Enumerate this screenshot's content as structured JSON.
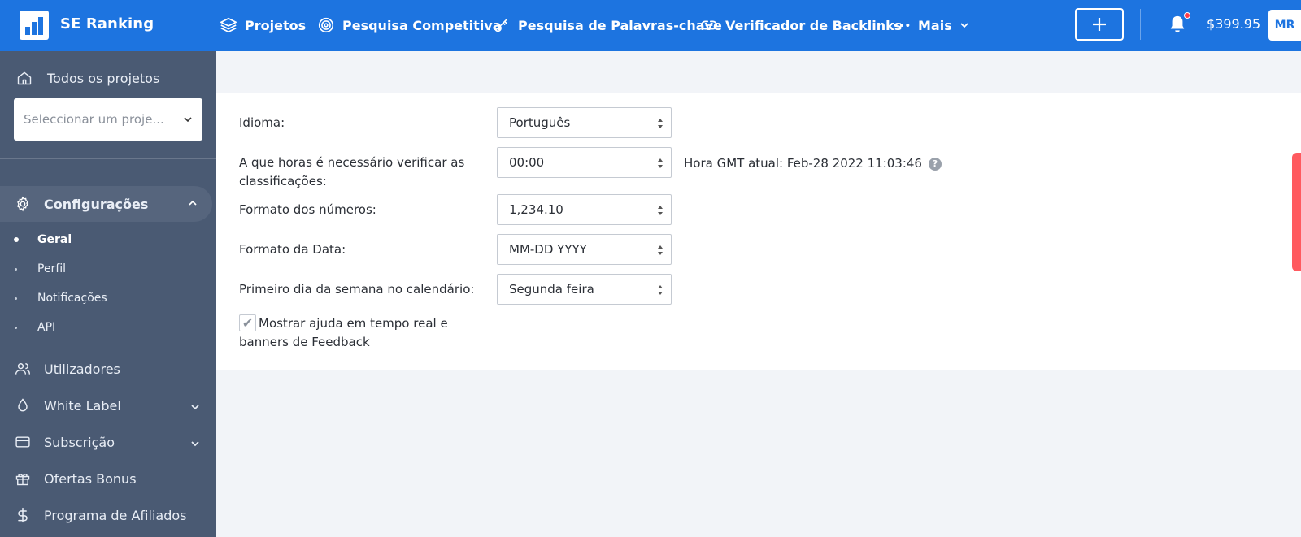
{
  "brand": {
    "name": "SE Ranking"
  },
  "nav": {
    "items": [
      {
        "label": "Projetos",
        "icon": "layers-icon"
      },
      {
        "label": "Pesquisa Competitiva",
        "icon": "target-icon"
      },
      {
        "label": "Pesquisa de Palavras-chave",
        "icon": "key-icon"
      },
      {
        "label": "Verificador de Backlinks",
        "icon": "link-icon"
      },
      {
        "label": "Mais",
        "icon": "more-icon"
      }
    ],
    "balance": "$399.95",
    "avatar": "MR"
  },
  "sidebar": {
    "all_projects": "Todos os projetos",
    "project_select_placeholder": "Seleccionar um proje...",
    "settings_label": "Configurações",
    "settings_sub": [
      "Geral",
      "Perfil",
      "Notificações",
      "API"
    ],
    "items": [
      {
        "label": "Utilizadores",
        "icon": "users-icon"
      },
      {
        "label": "White Label",
        "icon": "drop-icon"
      },
      {
        "label": "Subscrição",
        "icon": "card-icon"
      },
      {
        "label": "Ofertas Bonus",
        "icon": "gift-icon"
      },
      {
        "label": "Programa de Afiliados",
        "icon": "dollar-icon"
      }
    ]
  },
  "settings": {
    "language_label": "Idioma:",
    "language_value": "Português",
    "check_time_label": "A que horas é necessário verificar as classificações:",
    "check_time_value": "00:00",
    "gmt_text": "Hora GMT atual: Feb-28 2022 11:03:46",
    "number_format_label": "Formato dos números:",
    "number_format_value": "1,234.10",
    "date_format_label": "Formato da Data:",
    "date_format_value": "MM-DD YYYY",
    "first_day_label": "Primeiro dia da semana no calendário:",
    "first_day_value": "Segunda feira",
    "help_checkbox_label": "Mostrar ajuda em tempo real e banners de Feedback",
    "help_checked": true
  },
  "colors": {
    "primary": "#1d74e0",
    "sidebar": "#4a5a73",
    "accent_tab": "#ff5a5f"
  }
}
